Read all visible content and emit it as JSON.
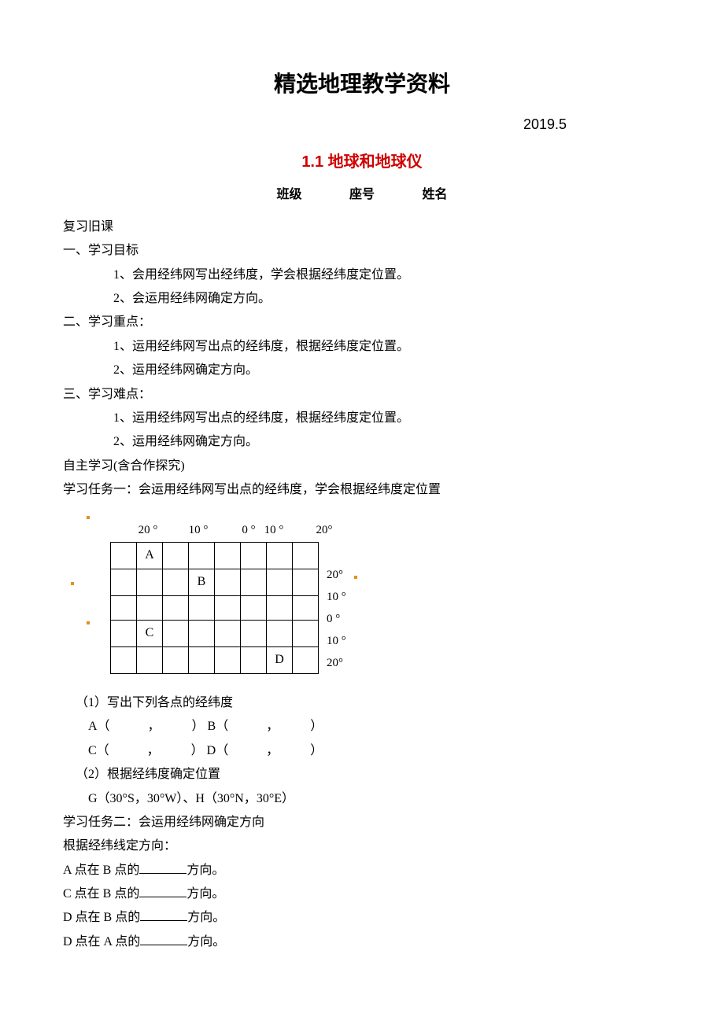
{
  "page": {
    "main_title": "精选地理教学资料",
    "date": "2019.5",
    "section_num": "1.1 地球和地球仪",
    "header": {
      "class": "班级",
      "seat": "座号",
      "name": "姓名"
    }
  },
  "body": {
    "review": "复习旧课",
    "h1": "一、学习目标",
    "h1_1": "1、会用经纬网写出经纬度，学会根据经纬度定位置。",
    "h1_2": "2、会运用经纬网确定方向。",
    "h2": "二、学习重点：",
    "h2_1": "1、运用经纬网写出点的经纬度，根据经纬度定位置。",
    "h2_2": "2、运用经纬网确定方向。",
    "h3": "三、学习难点：",
    "h3_1": "1、运用经纬网写出点的经纬度，根据经纬度定位置。",
    "h3_2": "2、运用经纬网确定方向。",
    "self": "自主学习(含合作探究)",
    "task1": "学习任务一：会运用经纬网写出点的经纬度，学会根据经纬度定位置"
  },
  "chart_data": {
    "type": "table",
    "title": "经纬网格图",
    "top_labels": [
      "20 °",
      "10 °",
      "0 °",
      "10 °",
      "20°"
    ],
    "right_labels": [
      "20°",
      "10 °",
      "0 °",
      "10 °",
      "20°"
    ],
    "cells": {
      "A": {
        "row": 0,
        "col": 1
      },
      "B": {
        "row": 1,
        "col": 3
      },
      "C": {
        "row": 3,
        "col": 1
      },
      "D": {
        "row": 4,
        "col": 6
      }
    }
  },
  "q": {
    "q1": "（1）写出下列各点的经纬度",
    "q1_ab": "A（　　　，　　　） B（　　　，　　　）",
    "q1_cd": "C（　　　，　　　） D（　　　，　　　）",
    "q2": "（2）根据经纬度确定位置",
    "q2_gh": "G（30°S，30°W）、H（30°N，30°E）",
    "task2": "学习任务二：会运用经纬网确定方向",
    "dir_head": "根据经纬线定方向：",
    "d1a": "A 点在 B 点的",
    "d1b": "方向。",
    "d2a": "C 点在 B 点的",
    "d3a": "D 点在 B 点的",
    "d4a": "D 点在 A 点的"
  }
}
